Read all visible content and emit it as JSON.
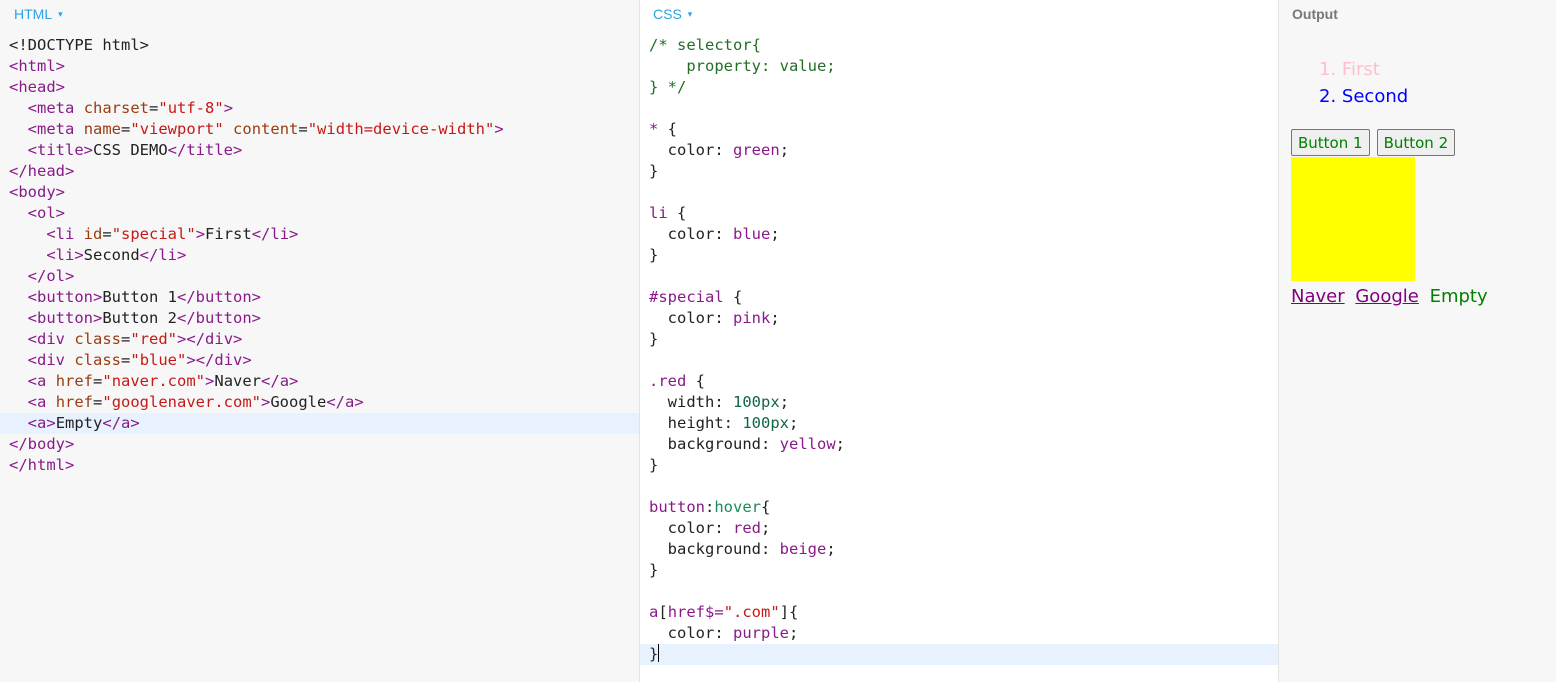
{
  "html_pane": {
    "title": "HTML",
    "caret": "▾",
    "lines": [
      "<!DOCTYPE html>",
      "<html>",
      "<head>",
      "  <meta charset=\"utf-8\">",
      "  <meta name=\"viewport\" content=\"width=device-width\">",
      "  <title>CSS DEMO</title>",
      "</head>",
      "<body>",
      "  <ol>",
      "    <li id=\"special\">First</li>",
      "    <li>Second</li>",
      "  </ol>",
      "  <button>Button 1</button>",
      "  <button>Button 2</button>",
      "  <div class=\"red\"></div>",
      "  <div class=\"blue\"></div>",
      "  <a href=\"naver.com\">Naver</a>",
      "  <a href=\"googlenaver.com\">Google</a>",
      "  <a>Empty</a>",
      "</body>",
      "</html>"
    ],
    "active_line": 18
  },
  "css_pane": {
    "title": "CSS",
    "caret": "▾",
    "lines": [
      "/* selector{",
      "    property: value;",
      "} */",
      "",
      "* {",
      "  color: green;",
      "}",
      "",
      "li {",
      "  color: blue;",
      "}",
      "",
      "#special {",
      "  color: pink;",
      "}",
      "",
      ".red {",
      "  width: 100px;",
      "  height: 100px;",
      "  background: yellow;",
      "}",
      "",
      "button:hover{",
      "  color: red;",
      "  background: beige;",
      "}",
      "",
      "a[href$=\".com\"]{",
      "  color: purple;",
      "}"
    ],
    "active_line": 29
  },
  "output_pane": {
    "title": "Output",
    "list": [
      {
        "marker": "1.",
        "text": "First",
        "color": "#ffc0cb"
      },
      {
        "marker": "2.",
        "text": "Second",
        "color": "#0000ff"
      }
    ],
    "button1": "Button 1",
    "button2": "Button 2",
    "box_color": "#ffff00",
    "link_naver": "Naver",
    "link_google": "Google",
    "empty_text": "Empty"
  }
}
